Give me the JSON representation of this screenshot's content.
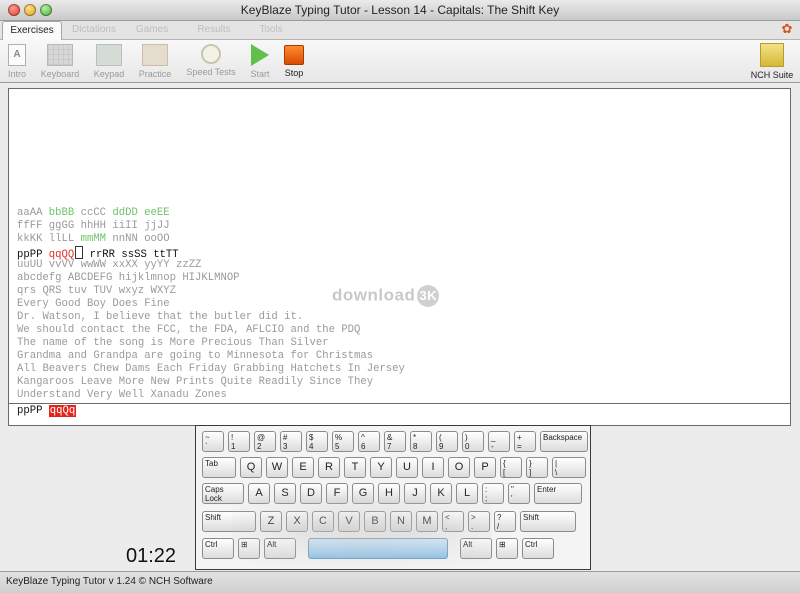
{
  "window": {
    "title": "KeyBlaze Typing Tutor - Lesson 14 - Capitals: The Shift Key"
  },
  "tabs": [
    {
      "label": "Exercises",
      "active": true
    },
    {
      "label": "Dictations",
      "active": false
    },
    {
      "label": "Games",
      "active": false
    },
    {
      "label": "Results",
      "active": false
    },
    {
      "label": "Tools",
      "active": false
    }
  ],
  "toolbar": {
    "intro": "Intro",
    "keyboard": "Keyboard",
    "keypad": "Keypad",
    "practice": "Practice",
    "speed_tests": "Speed Tests",
    "start": "Start",
    "stop": "Stop",
    "nch_suite": "NCH Suite",
    "intro_icon_text": "A"
  },
  "exercise": {
    "lines": [
      [
        "aaAA",
        "bbBB",
        "ccCC",
        "ddDD",
        "eeEE"
      ],
      [
        "ffFF",
        "ggGG",
        "hhHH",
        "iiII",
        "jjJJ"
      ],
      [
        "kkKK",
        "llLL",
        "mmMM",
        "nnNN",
        "ooOO"
      ],
      [
        "ppPP",
        "qqQQ",
        "rrRR",
        "ssSS",
        "ttTT"
      ],
      [
        "uuUU",
        "vvVV",
        "wwWW",
        "xxXX",
        "yyYY",
        "zzZZ"
      ],
      [
        "abcdefg",
        "ABCDEFG",
        "hijklmnop",
        "HIJKLMNOP"
      ],
      [
        "qrs",
        "QRS",
        "tuv",
        "TUV",
        "wxyz",
        "WXYZ"
      ],
      [
        "Every",
        "Good",
        "Boy",
        "Does",
        "Fine"
      ],
      [
        "Dr.",
        "Watson,",
        "I",
        "believe",
        "that",
        "the",
        "butler",
        "did",
        "it."
      ],
      [
        "We",
        "should",
        "contact",
        "the",
        "FCC,",
        "the",
        "FDA,",
        "AFLCIO",
        "and",
        "the",
        "PDQ"
      ],
      [
        "The",
        "name",
        "of",
        "the",
        "song",
        "is",
        "More",
        "Precious",
        "Than",
        "Silver"
      ],
      [
        "Grandma",
        "and",
        "Grandpa",
        "are",
        "going",
        "to",
        "Minnesota",
        "for",
        "Christmas"
      ],
      [
        "All",
        "Beavers",
        "Chew",
        "Dams",
        "Each",
        "Friday",
        "Grabbing",
        "Hatchets",
        "In",
        "Jersey"
      ],
      [
        "Kangaroos",
        "Leave",
        "More",
        "New",
        "Prints",
        "Quite",
        "Readily",
        "Since",
        "They"
      ],
      [
        "Understand",
        "Very",
        "Well",
        "Xanadu",
        "Zones"
      ]
    ],
    "typed_ok": "ppPP",
    "typed_error": "qqQq",
    "watermark": "download",
    "watermark_badge": "3K"
  },
  "keyboard": {
    "rows": [
      [
        [
          "~",
          "`"
        ],
        [
          "!",
          "1"
        ],
        [
          "@",
          "2"
        ],
        [
          "#",
          "3"
        ],
        [
          "$",
          "4"
        ],
        [
          "%",
          "5"
        ],
        [
          "^",
          "6"
        ],
        [
          "&",
          "7"
        ],
        [
          "*",
          "8"
        ],
        [
          "(",
          "9"
        ],
        [
          ")",
          "0"
        ],
        [
          "_",
          "-"
        ],
        [
          "+",
          "="
        ],
        [
          "Backspace",
          ""
        ]
      ],
      [
        [
          "Tab",
          ""
        ],
        [
          "Q",
          ""
        ],
        [
          "W",
          ""
        ],
        [
          "E",
          ""
        ],
        [
          "R",
          ""
        ],
        [
          "T",
          ""
        ],
        [
          "Y",
          ""
        ],
        [
          "U",
          ""
        ],
        [
          "I",
          ""
        ],
        [
          "O",
          ""
        ],
        [
          "P",
          ""
        ],
        [
          "{",
          "["
        ],
        [
          "}",
          "]"
        ],
        [
          "|",
          "\\"
        ]
      ],
      [
        [
          "Caps Lock",
          ""
        ],
        [
          "A",
          ""
        ],
        [
          "S",
          ""
        ],
        [
          "D",
          ""
        ],
        [
          "F",
          ""
        ],
        [
          "G",
          ""
        ],
        [
          "H",
          ""
        ],
        [
          "J",
          ""
        ],
        [
          "K",
          ""
        ],
        [
          "L",
          ""
        ],
        [
          ":",
          ";"
        ],
        [
          "\"",
          "'"
        ],
        [
          "Enter",
          ""
        ]
      ],
      [
        [
          "Shift",
          ""
        ],
        [
          "Z",
          ""
        ],
        [
          "X",
          ""
        ],
        [
          "C",
          ""
        ],
        [
          "V",
          ""
        ],
        [
          "B",
          ""
        ],
        [
          "N",
          ""
        ],
        [
          "M",
          ""
        ],
        [
          "<",
          ","
        ],
        [
          ">",
          "."
        ],
        [
          "?",
          "/"
        ],
        [
          "Shift",
          ""
        ]
      ],
      [
        [
          "Ctrl",
          ""
        ],
        [
          "⊞",
          ""
        ],
        [
          "Alt",
          ""
        ],
        [
          "",
          ""
        ],
        [
          "Alt",
          ""
        ],
        [
          "⊞",
          ""
        ],
        [
          "Ctrl",
          ""
        ]
      ]
    ]
  },
  "timer": "01:22",
  "status": {
    "text": "KeyBlaze Typing Tutor v 1.24 © NCH Software"
  }
}
